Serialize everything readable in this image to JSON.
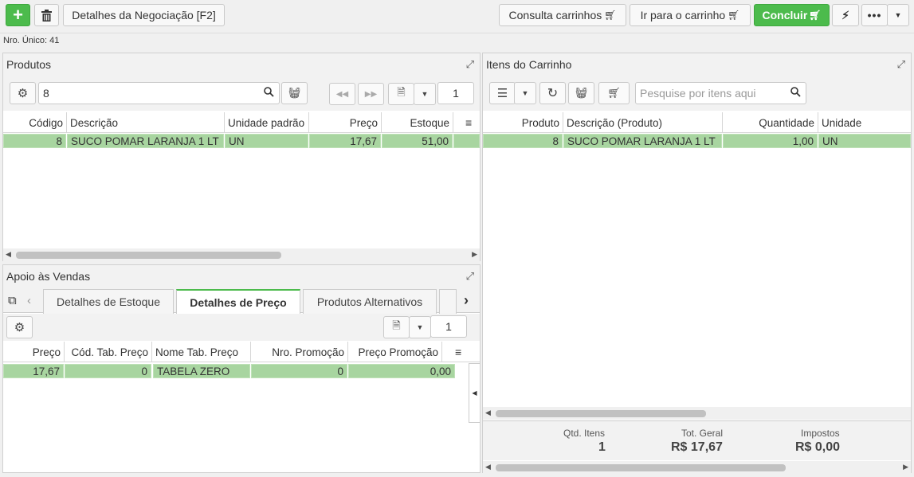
{
  "toolbar": {
    "add_icon": "plus-icon",
    "delete_icon": "trash-icon",
    "details_label": "Detalhes da Negociação [F2]",
    "consulta_label": "Consulta carrinhos",
    "ir_label": "Ir para o carrinho",
    "concluir_label": "Concluir",
    "flash_icon": "lightning-icon",
    "more_icon": "ellipsis-icon",
    "dropdown_icon": "caret-down-icon"
  },
  "nro_unico": "Nro. Único: 41",
  "produtos": {
    "title": "Produtos",
    "search_value": "8",
    "page": "1",
    "columns": [
      "Código",
      "Descrição",
      "Unidade padrão",
      "Preço",
      "Estoque"
    ],
    "rows": [
      {
        "codigo": "8",
        "descricao": "SUCO POMAR LARANJA 1 LT",
        "unidade": "UN",
        "preco": "17,67",
        "estoque": "51,00"
      }
    ]
  },
  "carrinho": {
    "title": "Itens do Carrinho",
    "search_placeholder": "Pesquise por itens aqui",
    "columns": [
      "Produto",
      "Descrição (Produto)",
      "Quantidade",
      "Unidade"
    ],
    "rows": [
      {
        "produto": "8",
        "descricao": "SUCO POMAR LARANJA 1 LT",
        "quantidade": "1,00",
        "unidade": "UN"
      }
    ],
    "summary": {
      "qtd_label": "Qtd. Itens",
      "qtd_value": "1",
      "tot_label": "Tot. Geral",
      "tot_value": "R$ 17,67",
      "imp_label": "Impostos",
      "imp_value": "R$ 0,00"
    }
  },
  "apoio": {
    "title": "Apoio às Vendas",
    "tabs": [
      "Detalhes de Estoque",
      "Detalhes de Preço",
      "Produtos Alternativos"
    ],
    "active_tab": "Detalhes de Preço",
    "page": "1",
    "columns": [
      "Preço",
      "Cód. Tab. Preço",
      "Nome Tab. Preço",
      "Nro. Promoção",
      "Preço Promoção"
    ],
    "rows": [
      {
        "preco": "17,67",
        "cod_tab": "0",
        "nome_tab": "TABELA ZERO",
        "nro_promo": "0",
        "preco_promo": "0,00"
      }
    ]
  },
  "colors": {
    "accent": "#4cbb4c",
    "selected_row": "#a8d5a0"
  }
}
